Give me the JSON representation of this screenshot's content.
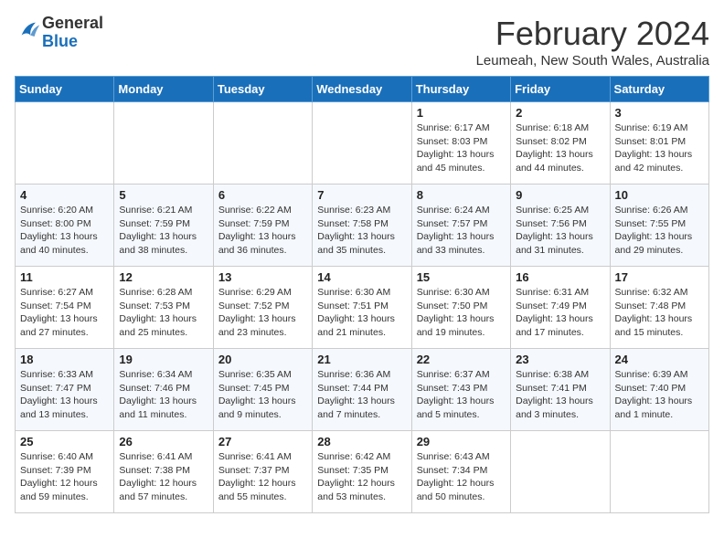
{
  "header": {
    "logo_general": "General",
    "logo_blue": "Blue",
    "main_title": "February 2024",
    "subtitle": "Leumeah, New South Wales, Australia"
  },
  "days_of_week": [
    "Sunday",
    "Monday",
    "Tuesday",
    "Wednesday",
    "Thursday",
    "Friday",
    "Saturday"
  ],
  "weeks": [
    [
      {
        "day": "",
        "info": ""
      },
      {
        "day": "",
        "info": ""
      },
      {
        "day": "",
        "info": ""
      },
      {
        "day": "",
        "info": ""
      },
      {
        "day": "1",
        "info": "Sunrise: 6:17 AM\nSunset: 8:03 PM\nDaylight: 13 hours\nand 45 minutes."
      },
      {
        "day": "2",
        "info": "Sunrise: 6:18 AM\nSunset: 8:02 PM\nDaylight: 13 hours\nand 44 minutes."
      },
      {
        "day": "3",
        "info": "Sunrise: 6:19 AM\nSunset: 8:01 PM\nDaylight: 13 hours\nand 42 minutes."
      }
    ],
    [
      {
        "day": "4",
        "info": "Sunrise: 6:20 AM\nSunset: 8:00 PM\nDaylight: 13 hours\nand 40 minutes."
      },
      {
        "day": "5",
        "info": "Sunrise: 6:21 AM\nSunset: 7:59 PM\nDaylight: 13 hours\nand 38 minutes."
      },
      {
        "day": "6",
        "info": "Sunrise: 6:22 AM\nSunset: 7:59 PM\nDaylight: 13 hours\nand 36 minutes."
      },
      {
        "day": "7",
        "info": "Sunrise: 6:23 AM\nSunset: 7:58 PM\nDaylight: 13 hours\nand 35 minutes."
      },
      {
        "day": "8",
        "info": "Sunrise: 6:24 AM\nSunset: 7:57 PM\nDaylight: 13 hours\nand 33 minutes."
      },
      {
        "day": "9",
        "info": "Sunrise: 6:25 AM\nSunset: 7:56 PM\nDaylight: 13 hours\nand 31 minutes."
      },
      {
        "day": "10",
        "info": "Sunrise: 6:26 AM\nSunset: 7:55 PM\nDaylight: 13 hours\nand 29 minutes."
      }
    ],
    [
      {
        "day": "11",
        "info": "Sunrise: 6:27 AM\nSunset: 7:54 PM\nDaylight: 13 hours\nand 27 minutes."
      },
      {
        "day": "12",
        "info": "Sunrise: 6:28 AM\nSunset: 7:53 PM\nDaylight: 13 hours\nand 25 minutes."
      },
      {
        "day": "13",
        "info": "Sunrise: 6:29 AM\nSunset: 7:52 PM\nDaylight: 13 hours\nand 23 minutes."
      },
      {
        "day": "14",
        "info": "Sunrise: 6:30 AM\nSunset: 7:51 PM\nDaylight: 13 hours\nand 21 minutes."
      },
      {
        "day": "15",
        "info": "Sunrise: 6:30 AM\nSunset: 7:50 PM\nDaylight: 13 hours\nand 19 minutes."
      },
      {
        "day": "16",
        "info": "Sunrise: 6:31 AM\nSunset: 7:49 PM\nDaylight: 13 hours\nand 17 minutes."
      },
      {
        "day": "17",
        "info": "Sunrise: 6:32 AM\nSunset: 7:48 PM\nDaylight: 13 hours\nand 15 minutes."
      }
    ],
    [
      {
        "day": "18",
        "info": "Sunrise: 6:33 AM\nSunset: 7:47 PM\nDaylight: 13 hours\nand 13 minutes."
      },
      {
        "day": "19",
        "info": "Sunrise: 6:34 AM\nSunset: 7:46 PM\nDaylight: 13 hours\nand 11 minutes."
      },
      {
        "day": "20",
        "info": "Sunrise: 6:35 AM\nSunset: 7:45 PM\nDaylight: 13 hours\nand 9 minutes."
      },
      {
        "day": "21",
        "info": "Sunrise: 6:36 AM\nSunset: 7:44 PM\nDaylight: 13 hours\nand 7 minutes."
      },
      {
        "day": "22",
        "info": "Sunrise: 6:37 AM\nSunset: 7:43 PM\nDaylight: 13 hours\nand 5 minutes."
      },
      {
        "day": "23",
        "info": "Sunrise: 6:38 AM\nSunset: 7:41 PM\nDaylight: 13 hours\nand 3 minutes."
      },
      {
        "day": "24",
        "info": "Sunrise: 6:39 AM\nSunset: 7:40 PM\nDaylight: 13 hours\nand 1 minute."
      }
    ],
    [
      {
        "day": "25",
        "info": "Sunrise: 6:40 AM\nSunset: 7:39 PM\nDaylight: 12 hours\nand 59 minutes."
      },
      {
        "day": "26",
        "info": "Sunrise: 6:41 AM\nSunset: 7:38 PM\nDaylight: 12 hours\nand 57 minutes."
      },
      {
        "day": "27",
        "info": "Sunrise: 6:41 AM\nSunset: 7:37 PM\nDaylight: 12 hours\nand 55 minutes."
      },
      {
        "day": "28",
        "info": "Sunrise: 6:42 AM\nSunset: 7:35 PM\nDaylight: 12 hours\nand 53 minutes."
      },
      {
        "day": "29",
        "info": "Sunrise: 6:43 AM\nSunset: 7:34 PM\nDaylight: 12 hours\nand 50 minutes."
      },
      {
        "day": "",
        "info": ""
      },
      {
        "day": "",
        "info": ""
      }
    ]
  ]
}
